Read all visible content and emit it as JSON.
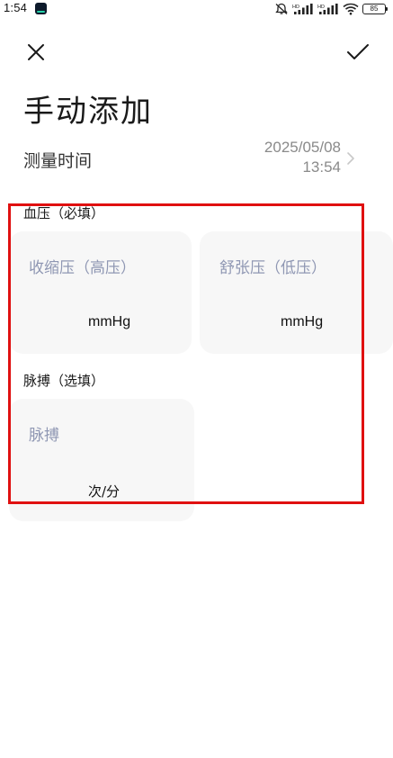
{
  "status_bar": {
    "time": "1:54",
    "battery": "85",
    "icons": [
      "app-notification-icon",
      "mute-icon",
      "hd-signal-icon-1",
      "hd-signal-icon-2",
      "wifi-icon",
      "battery-icon"
    ]
  },
  "header": {
    "close_icon": "close-icon",
    "confirm_icon": "check-icon",
    "title": "手动添加"
  },
  "measure_time": {
    "label": "测量时间",
    "date": "2025/05/08",
    "time": "13:54"
  },
  "blood_pressure": {
    "section_label": "血压（必填）",
    "systolic": {
      "placeholder": "收缩压（高压）",
      "unit": "mmHg",
      "value": ""
    },
    "diastolic": {
      "placeholder": "舒张压（低压）",
      "unit": "mmHg",
      "value": ""
    }
  },
  "pulse": {
    "section_label": "脉搏（选填）",
    "placeholder": "脉搏",
    "unit": "次/分",
    "value": ""
  },
  "colors": {
    "highlight": "#e01010",
    "card_background": "#f7f7f7",
    "placeholder": "#8f97b3"
  }
}
